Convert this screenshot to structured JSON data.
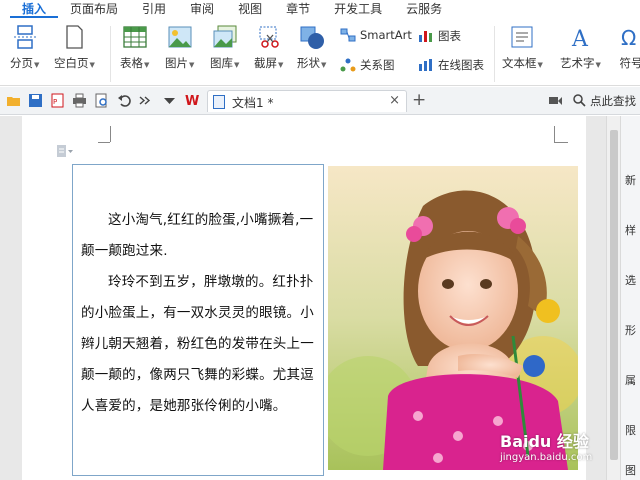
{
  "tabs": [
    "插入",
    "页面布局",
    "引用",
    "审阅",
    "视图",
    "章节",
    "开发工具",
    "云服务"
  ],
  "ribbon": {
    "page_break": "分页",
    "blank_page": "空白页",
    "table": "表格",
    "picture": "图片",
    "gallery": "图库",
    "screenshot": "截屏",
    "shape": "形状",
    "smartart": "SmartArt",
    "chart": "图表",
    "relation": "关系图",
    "online_chart": "在线图表",
    "textbox": "文本框",
    "wordart": "艺术字",
    "symbol": "符号"
  },
  "doc_tab": {
    "title": "文档1 *",
    "close": "×"
  },
  "new_tab": "+",
  "search_label": "点此查找",
  "document": {
    "paragraphs": [
      "这小淘气,红红的脸蛋,小嘴撅着,一颠一颠跑过来.",
      "玲玲不到五岁，胖墩墩的。红扑扑的小脸蛋上，有一双水灵灵的眼镜。小辫儿朝天翘着，粉红色的发带在头上一颠一颠的，像两只飞舞的彩蝶。尤其逗人喜爱的，是她那张伶俐的小嘴。"
    ]
  },
  "watermark": {
    "brand": "Baidu 经验",
    "url": "jingyan.baidu.com"
  },
  "right_pane": [
    "新",
    "样",
    "选",
    "形",
    "属",
    "限",
    "图"
  ],
  "colors": {
    "accent": "#1a6fd6",
    "wps_red": "#d0161b"
  }
}
